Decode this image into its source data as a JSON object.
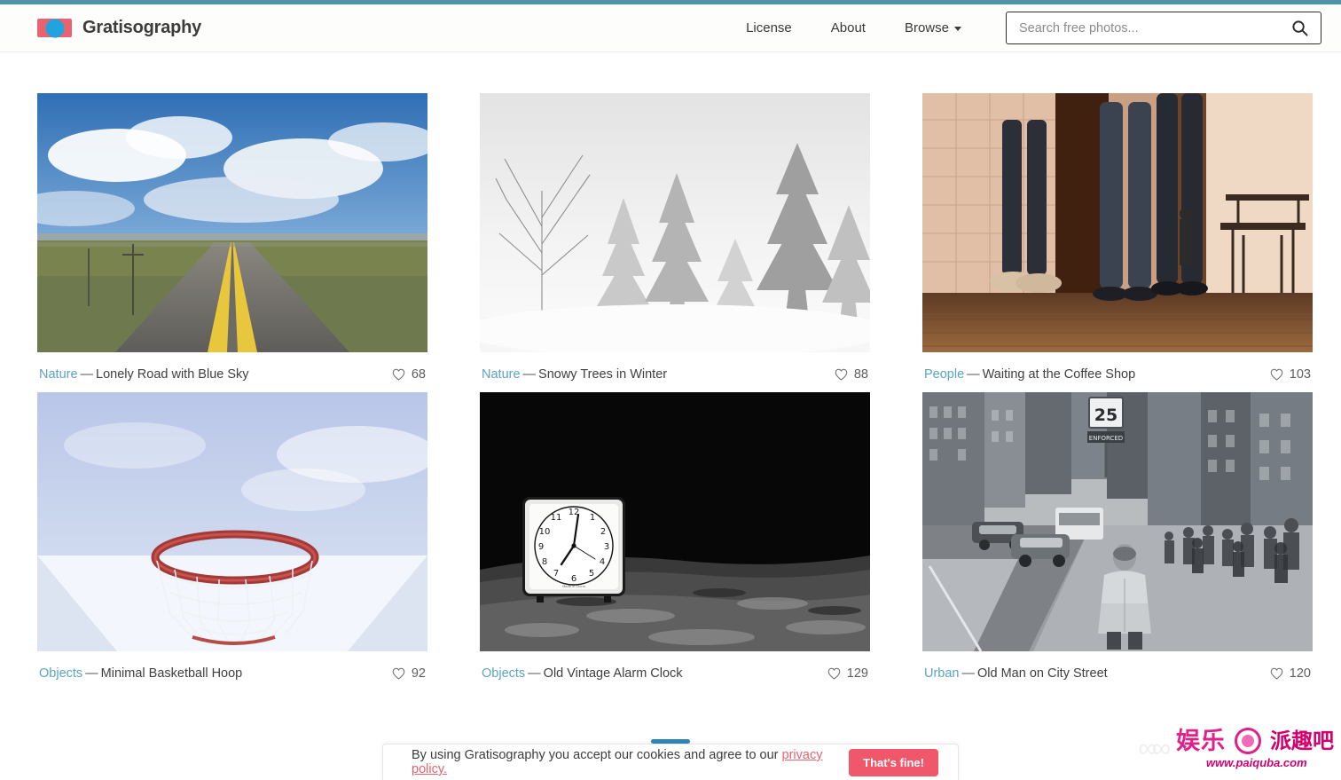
{
  "site": {
    "brand_name": "Gratisography",
    "logo_icon": "camera-logo-icon"
  },
  "nav": {
    "items": [
      {
        "label": "License",
        "has_caret": false
      },
      {
        "label": "About",
        "has_caret": false
      },
      {
        "label": "Browse",
        "has_caret": true
      }
    ]
  },
  "search": {
    "placeholder": "Search free photos...",
    "value": "",
    "icon": "search-icon"
  },
  "gallery": {
    "photos": [
      {
        "category": "Nature",
        "separator": "—",
        "title": "Lonely Road with Blue Sky",
        "likes": "68",
        "like_icon": "heart-outline-icon",
        "scene": "road"
      },
      {
        "category": "Nature",
        "separator": "—",
        "title": "Snowy Trees in Winter",
        "likes": "88",
        "like_icon": "heart-outline-icon",
        "scene": "snow"
      },
      {
        "category": "People",
        "separator": "—",
        "title": "Waiting at the Coffee Shop",
        "likes": "103",
        "like_icon": "heart-outline-icon",
        "scene": "coffee"
      },
      {
        "category": "Objects",
        "separator": "—",
        "title": "Minimal Basketball Hoop",
        "likes": "92",
        "like_icon": "heart-outline-icon",
        "scene": "hoop"
      },
      {
        "category": "Objects",
        "separator": "—",
        "title": "Old Vintage Alarm Clock",
        "likes": "129",
        "like_icon": "heart-outline-icon",
        "scene": "clock"
      },
      {
        "category": "Urban",
        "separator": "—",
        "title": "Old Man on City Street",
        "likes": "120",
        "like_icon": "heart-outline-icon",
        "scene": "street"
      }
    ]
  },
  "cookie_banner": {
    "text_before": "By using Gratisography you accept our cookies and agree to our ",
    "link_label": "privacy policy.",
    "accept_label": "That's fine!"
  },
  "watermark": {
    "brand_cn": "娱乐",
    "brand_cn2": "派趣吧",
    "url": "www.paiquba.com"
  },
  "colors": {
    "top_strip": "#4f93a8",
    "logo_red": "#e8636f",
    "logo_blue": "#23a3dd",
    "category_link": "#5ba4c4",
    "accept_button": "#f0576b",
    "cookie_link": "#e8636f",
    "watermark_pink": "#e0218a"
  }
}
